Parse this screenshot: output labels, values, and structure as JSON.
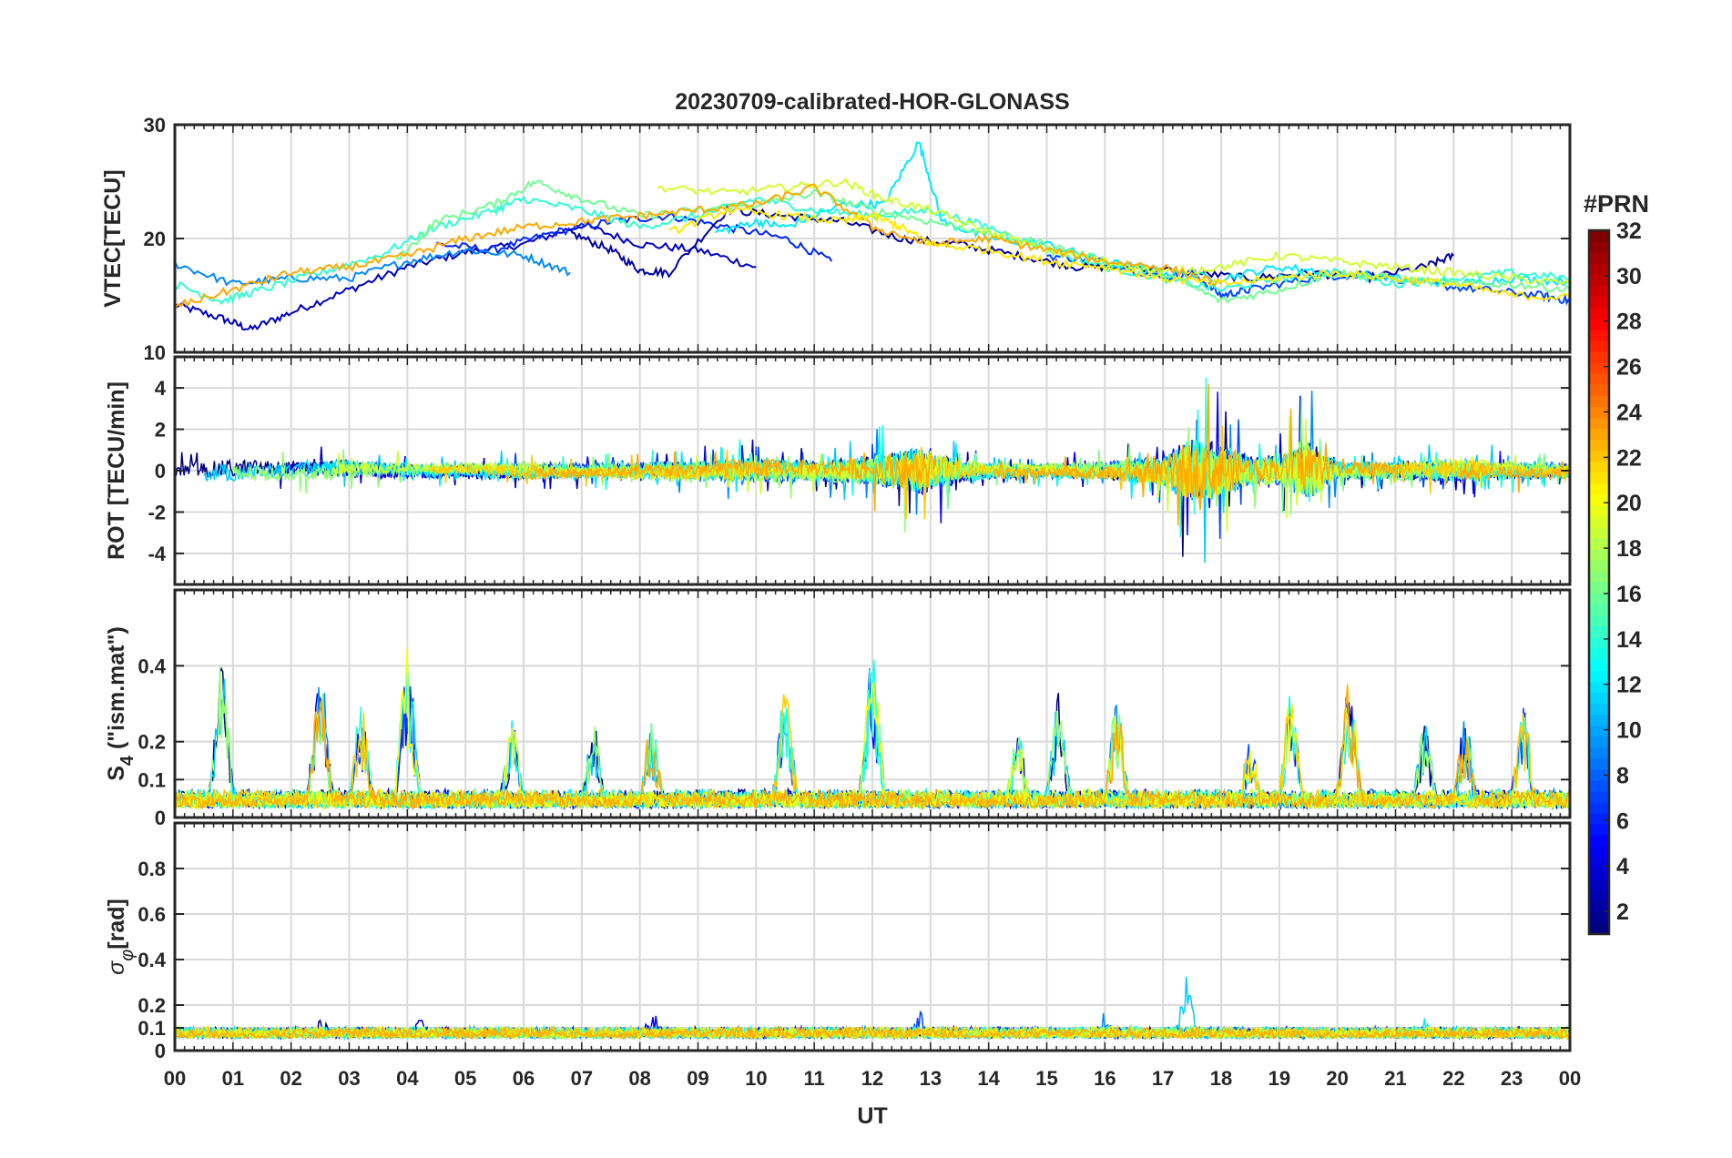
{
  "title": "20230709-calibrated-HOR-GLONASS",
  "colorbar": {
    "label": "#PRN",
    "ticks": [
      "2",
      "4",
      "6",
      "8",
      "10",
      "12",
      "14",
      "16",
      "18",
      "20",
      "22",
      "24",
      "26",
      "28",
      "30",
      "32"
    ],
    "range": [
      1,
      32
    ]
  },
  "chart_data": [
    {
      "type": "line",
      "panel": "vtec",
      "ylabel": "VTEC[TECU]",
      "ylim": [
        10,
        30
      ],
      "yticks": [
        10,
        20,
        30
      ],
      "xlim": [
        0,
        24
      ],
      "grid": true,
      "note": "multiple GLONASS PRN series, colored by PRN number",
      "series": [
        {
          "prn": 3,
          "points": [
            [
              0,
              14.2
            ],
            [
              0.8,
              13.0
            ],
            [
              1.3,
              12.0
            ],
            [
              2.0,
              13.5
            ],
            [
              3,
              15.5
            ],
            [
              4,
              17.5
            ],
            [
              5,
              18.8
            ],
            [
              6,
              19.5
            ],
            [
              7,
              21.2
            ],
            [
              8,
              19.5
            ],
            [
              9,
              19.0
            ],
            [
              10,
              17.5
            ]
          ]
        },
        {
          "prn": 6,
          "points": [
            [
              4.5,
              19.5
            ],
            [
              5.5,
              19.0
            ],
            [
              6.5,
              20.5
            ],
            [
              7.5,
              21.5
            ],
            [
              8.5,
              22.0
            ],
            [
              9.5,
              21.0
            ],
            [
              10.5,
              20.0
            ],
            [
              11.3,
              18.0
            ]
          ]
        },
        {
          "prn": 2,
          "points": [
            [
              6.8,
              20.5
            ],
            [
              7.5,
              19.0
            ],
            [
              8,
              17.2
            ],
            [
              8.5,
              17.0
            ],
            [
              9.5,
              22.5
            ],
            [
              10.5,
              22.0
            ],
            [
              11.5,
              21.5
            ],
            [
              12.5,
              20.0
            ],
            [
              13.5,
              19.5
            ],
            [
              14.5,
              18.5
            ],
            [
              15.5,
              17.5
            ],
            [
              16.5,
              17.5
            ],
            [
              17.5,
              17.0
            ],
            [
              18.5,
              16.5
            ],
            [
              19.5,
              17.0
            ],
            [
              20.5,
              16.5
            ],
            [
              21.5,
              17.5
            ],
            [
              22,
              18.5
            ]
          ]
        },
        {
          "prn": 9,
          "points": [
            [
              0,
              17.8
            ],
            [
              1,
              16.0
            ],
            [
              2,
              16.5
            ],
            [
              3,
              16.5
            ],
            [
              4,
              18.0
            ],
            [
              5,
              19.0
            ],
            [
              6,
              18.5
            ],
            [
              6.8,
              17.0
            ]
          ]
        },
        {
          "prn": 7,
          "points": [
            [
              15,
              18.5
            ],
            [
              16,
              18.0
            ],
            [
              17,
              16.5
            ],
            [
              17.5,
              17.0
            ],
            [
              18,
              15.0
            ],
            [
              18.5,
              15.5
            ],
            [
              19.5,
              16.5
            ],
            [
              20.5,
              17.0
            ],
            [
              21.5,
              16.0
            ],
            [
              22.5,
              15.5
            ],
            [
              23.5,
              15.0
            ],
            [
              24,
              14.5
            ]
          ]
        },
        {
          "prn": 12,
          "points": [
            [
              9.3,
              20.5
            ],
            [
              10,
              21.5
            ],
            [
              10.5,
              21.0
            ],
            [
              11.5,
              23.0
            ],
            [
              12.2,
              23.0
            ],
            [
              12.8,
              28.5
            ],
            [
              13.2,
              21.5
            ],
            [
              14,
              20.0
            ],
            [
              15,
              19.5
            ],
            [
              16,
              18.0
            ],
            [
              17,
              17.0
            ],
            [
              18,
              16.5
            ],
            [
              19,
              17.5
            ],
            [
              20,
              17.0
            ],
            [
              21,
              16.5
            ],
            [
              22,
              16.0
            ],
            [
              23,
              16.5
            ],
            [
              24,
              16.2
            ]
          ]
        },
        {
          "prn": 14,
          "points": [
            [
              0,
              16.0
            ],
            [
              0.8,
              14.5
            ],
            [
              1.5,
              15.5
            ],
            [
              2.5,
              17.0
            ],
            [
              3.5,
              18.5
            ],
            [
              4.5,
              21.0
            ],
            [
              5.5,
              22.5
            ],
            [
              6,
              23.5
            ],
            [
              7,
              22.5
            ],
            [
              8,
              21.0
            ],
            [
              9,
              22.0
            ],
            [
              10,
              23.5
            ],
            [
              11,
              22.5
            ],
            [
              12,
              22.0
            ],
            [
              13,
              22.5
            ],
            [
              14,
              21.0
            ],
            [
              15,
              19.0
            ],
            [
              16,
              17.5
            ],
            [
              17,
              16.5
            ],
            [
              18,
              15.5
            ],
            [
              19,
              16.5
            ],
            [
              20,
              17.0
            ],
            [
              21,
              16.0
            ],
            [
              22,
              16.5
            ],
            [
              23,
              17.0
            ],
            [
              24,
              16.5
            ]
          ]
        },
        {
          "prn": 16,
          "points": [
            [
              3.8,
              18.0
            ],
            [
              4.5,
              21.5
            ],
            [
              5.5,
              23.0
            ],
            [
              6.2,
              25.0
            ],
            [
              7,
              23.5
            ],
            [
              8,
              22.0
            ],
            [
              9,
              22.5
            ],
            [
              10,
              23.0
            ],
            [
              11,
              24.0
            ],
            [
              12,
              22.5
            ],
            [
              13,
              21.5
            ],
            [
              14,
              20.5
            ],
            [
              15,
              19.5
            ],
            [
              16,
              18.0
            ],
            [
              17,
              17.0
            ],
            [
              18,
              14.5
            ],
            [
              19,
              15.5
            ],
            [
              20,
              17.0
            ],
            [
              21,
              16.5
            ],
            [
              22,
              16.0
            ],
            [
              23,
              16.0
            ],
            [
              24,
              15.5
            ]
          ]
        },
        {
          "prn": 19,
          "points": [
            [
              8.3,
              24.5
            ],
            [
              9.5,
              24.0
            ],
            [
              10.5,
              24.5
            ],
            [
              11.5,
              25.0
            ],
            [
              12.2,
              23.5
            ],
            [
              13,
              22.5
            ],
            [
              14,
              20.5
            ],
            [
              15,
              19.0
            ],
            [
              16,
              18.0
            ],
            [
              17,
              17.0
            ],
            [
              18,
              17.5
            ],
            [
              19,
              18.5
            ],
            [
              20,
              18.0
            ],
            [
              21,
              17.5
            ],
            [
              22,
              17.0
            ],
            [
              23,
              16.5
            ],
            [
              24,
              16.0
            ]
          ]
        },
        {
          "prn": 23,
          "points": [
            [
              0,
              14.0
            ],
            [
              1,
              15.5
            ],
            [
              2,
              17.0
            ],
            [
              3,
              17.5
            ],
            [
              4,
              18.5
            ],
            [
              5,
              20.0
            ],
            [
              6,
              21.0
            ],
            [
              7,
              21.5
            ],
            [
              8,
              22.0
            ],
            [
              9,
              22.5
            ],
            [
              10,
              23.0
            ],
            [
              11,
              24.5
            ],
            [
              12,
              21.0
            ],
            [
              13,
              19.5
            ],
            [
              14,
              20.0
            ],
            [
              15,
              19.0
            ],
            [
              16,
              18.0
            ],
            [
              17,
              17.5
            ],
            [
              18,
              16.0
            ]
          ]
        },
        {
          "prn": 21,
          "points": [
            [
              8.5,
              20.5
            ],
            [
              9.5,
              22.5
            ],
            [
              10.5,
              22.0
            ],
            [
              11.5,
              21.5
            ],
            [
              12,
              22.0
            ],
            [
              12.5,
              21.0
            ],
            [
              13,
              19.5
            ],
            [
              14,
              19.0
            ],
            [
              15,
              18.0
            ],
            [
              16,
              17.5
            ],
            [
              17,
              16.5
            ],
            [
              18,
              16.0
            ],
            [
              19,
              16.5
            ],
            [
              20,
              17.0
            ],
            [
              21,
              16.5
            ],
            [
              22,
              16.0
            ],
            [
              23,
              15.0
            ],
            [
              24,
              14.8
            ]
          ]
        }
      ]
    },
    {
      "type": "line",
      "panel": "rot",
      "ylabel": "ROT [TECU/min]",
      "ylim": [
        -5.5,
        5.5
      ],
      "yticks": [
        -4,
        -2,
        0,
        2,
        4
      ],
      "xlim": [
        0,
        24
      ],
      "grid": true,
      "note": "rate of TEC fluctuates mostly within ±1, bursts near 17–18 UT up to ±4.5",
      "envelope": [
        [
          0,
          1.0
        ],
        [
          1,
          1.5
        ],
        [
          2,
          1.0
        ],
        [
          3,
          1.2
        ],
        [
          4,
          0.8
        ],
        [
          5,
          0.8
        ],
        [
          6,
          1.0
        ],
        [
          7,
          0.8
        ],
        [
          8,
          1.0
        ],
        [
          9,
          1.2
        ],
        [
          10,
          1.5
        ],
        [
          11,
          1.2
        ],
        [
          12,
          2.0
        ],
        [
          12.8,
          3.6
        ],
        [
          13.5,
          1.5
        ],
        [
          14,
          0.8
        ],
        [
          15,
          0.8
        ],
        [
          16,
          1.0
        ],
        [
          17,
          2.0
        ],
        [
          17.4,
          4.5
        ],
        [
          17.8,
          4.5
        ],
        [
          18.5,
          2.0
        ],
        [
          19,
          2.0
        ],
        [
          19.5,
          4.5
        ],
        [
          20,
          1.0
        ],
        [
          21,
          1.0
        ],
        [
          22,
          1.5
        ],
        [
          23,
          1.0
        ],
        [
          24,
          0.8
        ]
      ]
    },
    {
      "type": "line",
      "panel": "s4",
      "ylabel": "S4 (\"ism.mat\")",
      "ylabel_main": "S",
      "ylabel_sub": "4",
      "ylabel_rest": " (\"ism.mat\")",
      "ylim": [
        0,
        0.6
      ],
      "yticks": [
        0,
        0.1,
        0.2,
        0.4
      ],
      "xlim": [
        0,
        24
      ],
      "grid": true,
      "peaks": [
        [
          0.8,
          0.41
        ],
        [
          2.5,
          0.4
        ],
        [
          3.2,
          0.3
        ],
        [
          4,
          0.45
        ],
        [
          5.8,
          0.26
        ],
        [
          7.2,
          0.25
        ],
        [
          8.2,
          0.25
        ],
        [
          10.5,
          0.34
        ],
        [
          12,
          0.43
        ],
        [
          14.5,
          0.22
        ],
        [
          15.2,
          0.33
        ],
        [
          16.2,
          0.3
        ],
        [
          18.5,
          0.2
        ],
        [
          19.2,
          0.33
        ],
        [
          20.2,
          0.37
        ],
        [
          21.5,
          0.25
        ],
        [
          22.2,
          0.26
        ],
        [
          23.2,
          0.3
        ]
      ]
    },
    {
      "type": "line",
      "panel": "sigma",
      "ylabel": "σφ[rad]",
      "ylabel_main": "σ",
      "ylabel_sub": "φ",
      "ylabel_rest": "[rad]",
      "ylim": [
        0,
        1
      ],
      "yticks": [
        0,
        0.1,
        0.2,
        0.4,
        0.6,
        0.8
      ],
      "xlim": [
        0,
        24
      ],
      "grid": true,
      "peaks": [
        [
          2.5,
          0.17
        ],
        [
          4.2,
          0.16
        ],
        [
          8.2,
          0.19
        ],
        [
          12.8,
          0.18
        ],
        [
          16,
          0.17
        ],
        [
          17.4,
          0.33
        ],
        [
          21.5,
          0.15
        ]
      ]
    }
  ],
  "xaxis": {
    "label": "UT",
    "ticks": [
      "00",
      "01",
      "02",
      "03",
      "04",
      "05",
      "06",
      "07",
      "08",
      "09",
      "10",
      "11",
      "12",
      "13",
      "14",
      "15",
      "16",
      "17",
      "18",
      "19",
      "20",
      "21",
      "22",
      "23",
      "00"
    ]
  }
}
